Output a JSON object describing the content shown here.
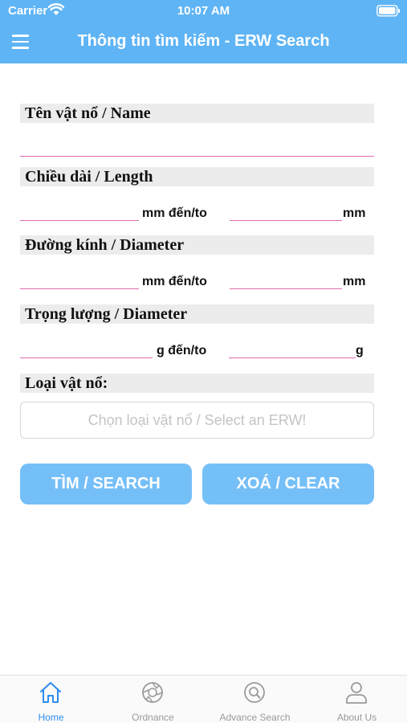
{
  "status_bar": {
    "carrier": "Carrier",
    "time": "10:07 AM"
  },
  "header": {
    "title": "Thông tin tìm kiếm - ERW Search"
  },
  "form": {
    "name_label": "Tên vật nổ / Name",
    "length_label": "Chiều dài / Length",
    "length_unit_mid": "mm  đến/to",
    "length_unit_end": "mm",
    "diameter_label": "Đường kính / Diameter",
    "diameter_unit_mid": "mm  đến/to",
    "diameter_unit_end": "mm",
    "weight_label": "Trọng lượng / Diameter",
    "weight_unit_mid": "g  đến/to",
    "weight_unit_end": "g",
    "type_label": "Loại vật nổ:",
    "type_placeholder": "Chọn loại vật nổ / Select an ERW!"
  },
  "buttons": {
    "search": "TÌM / SEARCH",
    "clear": "XOÁ / CLEAR"
  },
  "tabs": [
    {
      "label": "Home",
      "icon": "home-icon",
      "active": true
    },
    {
      "label": "Ordnance",
      "icon": "aperture-icon",
      "active": false
    },
    {
      "label": "Advance Search",
      "icon": "search-icon",
      "active": false
    },
    {
      "label": "About Us",
      "icon": "person-icon",
      "active": false
    }
  ],
  "colors": {
    "header": "#5fb4f5",
    "button": "#75bff8",
    "underline": "#e06bb3",
    "active_tab": "#2f8cf0",
    "inactive_tab": "#9a9a9a"
  }
}
